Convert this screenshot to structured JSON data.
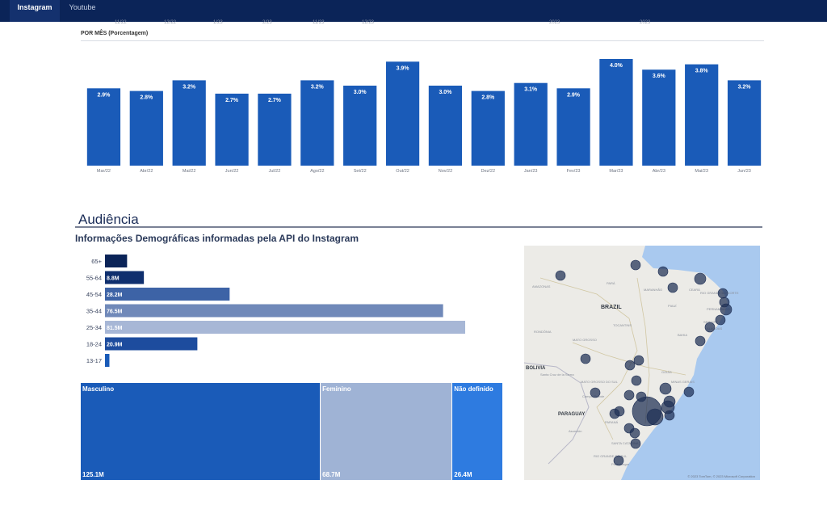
{
  "nav": {
    "tabs": [
      {
        "label": "Instagram",
        "active": true
      },
      {
        "label": "Youtube",
        "active": false
      }
    ]
  },
  "colors": {
    "navy": "#0b2458",
    "bar_blue": "#1a5bb8",
    "treemap_masculino": "#1a5bb8",
    "treemap_feminino": "#9fb3d5",
    "treemap_nao_definido": "#2e7be0",
    "map_water": "#a9c9ef",
    "map_land": "#ecebe7",
    "bubble": "#1e2f55"
  },
  "ghost_labels": [
    "11/22",
    "12/22",
    "1/23",
    "2/23",
    "11/23",
    "12/23",
    "2023",
    "2023"
  ],
  "monthly_chart": {
    "title": "POR MÊS (Porcentagem)"
  },
  "chart_data": [
    {
      "type": "bar",
      "title": "POR MÊS (Porcentagem)",
      "categories": [
        "Mar/22",
        "Abr/22",
        "Mai/22",
        "Jun/22",
        "Jul/22",
        "Ago/22",
        "Set/22",
        "Out/22",
        "Nov/22",
        "Dez/22",
        "Jan/23",
        "Fev/23",
        "Mar/23",
        "Abr/23",
        "Mai/23",
        "Jun/23"
      ],
      "values": [
        2.9,
        2.8,
        3.2,
        2.7,
        2.7,
        3.2,
        3.0,
        3.9,
        3.0,
        2.8,
        3.1,
        2.9,
        4.0,
        3.6,
        3.8,
        3.2
      ],
      "data_labels": [
        "2.9%",
        "2.8%",
        "3.2%",
        "2.7%",
        "2.7%",
        "3.2%",
        "3.0%",
        "3.9%",
        "3.0%",
        "2.8%",
        "3.1%",
        "2.9%",
        "4.0%",
        "3.6%",
        "3.8%",
        "3.2%"
      ],
      "ylim": [
        0,
        4.0
      ],
      "grid": false
    },
    {
      "type": "bar",
      "orientation": "horizontal",
      "categories": [
        "65+",
        "55-64",
        "45-54",
        "35-44",
        "25-34",
        "18-24",
        "13-17"
      ],
      "values": [
        5.0,
        8.8,
        28.2,
        76.5,
        81.5,
        20.9,
        1.0
      ],
      "data_labels": [
        "",
        "8.8M",
        "28.2M",
        "76.5M",
        "81.5M",
        "20.9M",
        ""
      ],
      "colors": [
        "#0b2458",
        "#0f2f6e",
        "#3d63a6",
        "#7089b9",
        "#a7b7d6",
        "#1d4c9e",
        "#1a5bb8"
      ]
    },
    {
      "type": "treemap",
      "categories": [
        "Masculino",
        "Feminino",
        "Não definido"
      ],
      "values": [
        125.1,
        68.7,
        26.4
      ],
      "data_labels": [
        "125.1M",
        "68.7M",
        "26.4M"
      ]
    }
  ],
  "audience": {
    "title": "Audiência",
    "subtitle": "Informações Demográficas informadas pela API do Instagram"
  },
  "map": {
    "labels": [
      "BRAZIL",
      "BOLIVIA",
      "PARAGUAY",
      "Santa Cruz de la Sierra",
      "Campo Grande",
      "Asunción",
      "Porto Alegre",
      "PARÁ",
      "MARANHÃO",
      "CEARÁ",
      "PIAUÍ",
      "PERNAMBUCO",
      "ALAGOAS",
      "BAHIA",
      "TOCANTINS",
      "RONDÔNIA",
      "MATO GROSSO",
      "MATO GROSSO DO SUL",
      "GOIÁS",
      "MINAS GERAIS",
      "PARANÁ",
      "SANTA CATARINA",
      "RIO GRANDE DO SUL",
      "AMAZONAS",
      "RIO GRANDE DO NORTE",
      "SERGIPE"
    ],
    "attribution": "© 2023 TomTom, © 2023 Microsoft Corporation"
  }
}
